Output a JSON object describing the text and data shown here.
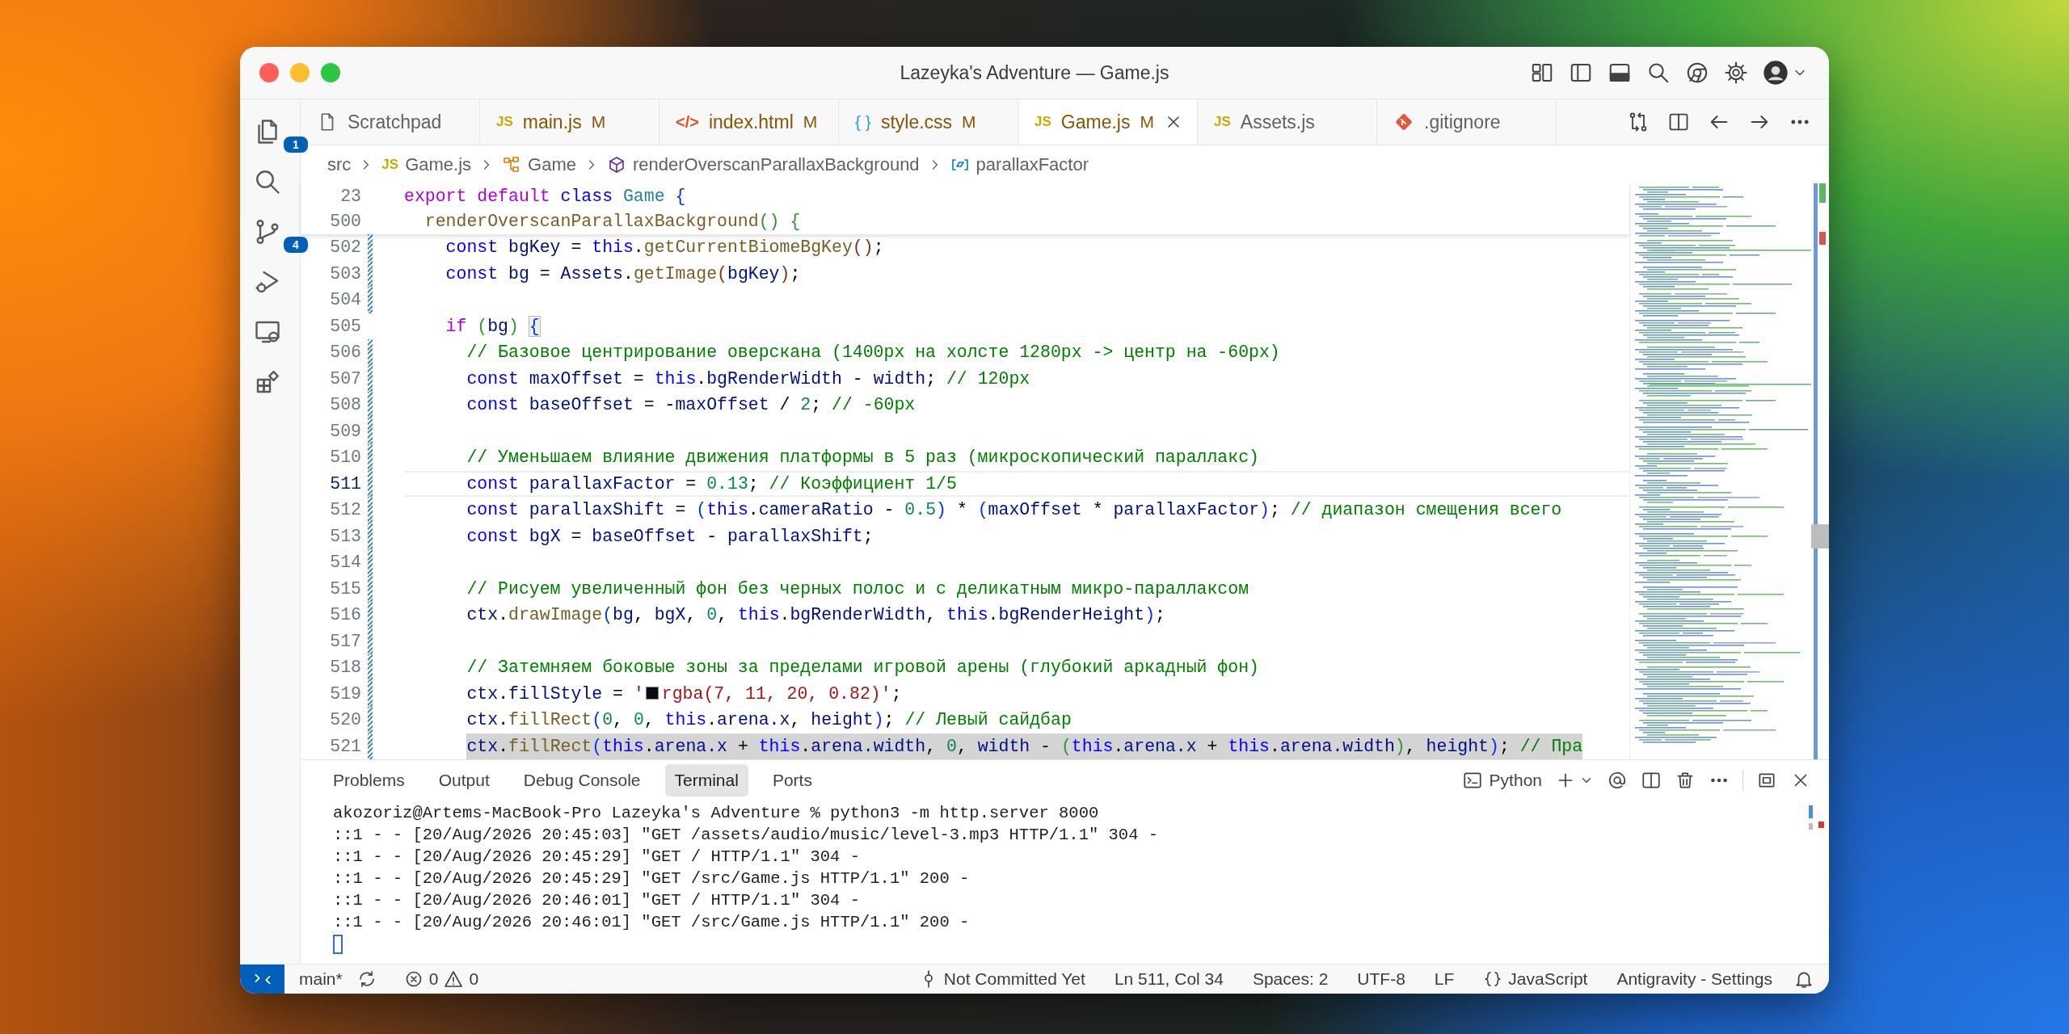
{
  "window": {
    "title": "Lazeyka's Adventure — Game.js"
  },
  "activity_bar": [
    {
      "kind": "explorer",
      "badge": "1"
    },
    {
      "kind": "search"
    },
    {
      "kind": "source_control",
      "badge": "4"
    },
    {
      "kind": "run_debug"
    },
    {
      "kind": "remote"
    },
    {
      "kind": "extensions"
    }
  ],
  "tabs": [
    {
      "label": "Scratchpad",
      "kind": "file",
      "selected": false
    },
    {
      "label": "main.js",
      "kind": "js",
      "icon_text": "JS",
      "badge": "M",
      "selected": false
    },
    {
      "label": "index.html",
      "kind": "html",
      "icon_text": "</>",
      "badge": "M",
      "selected": false
    },
    {
      "label": "style.css",
      "kind": "css",
      "icon_text": "{ }",
      "badge": "M",
      "selected": false
    },
    {
      "label": "Game.js",
      "kind": "js",
      "icon_text": "JS",
      "badge": "M",
      "selected": true
    },
    {
      "label": "Assets.js",
      "kind": "js",
      "icon_text": "JS",
      "selected": false
    },
    {
      "label": ".gitignore",
      "kind": "git",
      "selected": false
    }
  ],
  "breadcrumb": [
    {
      "kind": "folder",
      "label": "src"
    },
    {
      "kind": "js",
      "icon_text": "JS",
      "label": "Game.js"
    },
    {
      "kind": "class",
      "label": "Game"
    },
    {
      "kind": "method",
      "label": "renderOverscanParallaxBackground"
    },
    {
      "kind": "field",
      "label": "parallaxFactor"
    }
  ],
  "editor": {
    "sticky_lines": [
      {
        "number": "23",
        "tokens": [
          {
            "kind": "ctrl",
            "text": "export default "
          },
          {
            "kind": "kw",
            "text": "class "
          },
          {
            "kind": "type",
            "text": "Game "
          },
          {
            "kind": "br",
            "text": "{"
          }
        ],
        "children": [
          {
            "number": "500",
            "tokens": [
              {
                "kind": "fn",
                "text": "renderOverscanParallaxBackground"
              },
              {
                "kind": "br2",
                "text": "() {"
              }
            ]
          }
        ]
      }
    ],
    "lines": [
      {
        "number": "502",
        "changed": true,
        "current": false,
        "tokens": [
          {
            "kind": "kw",
            "text": "const "
          },
          {
            "kind": "var",
            "text": "bgKey"
          },
          {
            "kind": "p",
            "text": " = "
          },
          {
            "kind": "kw",
            "text": "this"
          },
          {
            "kind": "p",
            "text": "."
          },
          {
            "kind": "fn",
            "text": "getCurrentBiomeBgKey"
          },
          {
            "kind": "br3",
            "text": "()"
          },
          {
            "kind": "p",
            "text": ";"
          }
        ]
      },
      {
        "number": "503",
        "changed": true,
        "current": false,
        "tokens": [
          {
            "kind": "kw",
            "text": "const "
          },
          {
            "kind": "var",
            "text": "bg"
          },
          {
            "kind": "p",
            "text": " = "
          },
          {
            "kind": "var",
            "text": "Assets"
          },
          {
            "kind": "p",
            "text": "."
          },
          {
            "kind": "fn",
            "text": "getImage"
          },
          {
            "kind": "br3",
            "text": "("
          },
          {
            "kind": "var",
            "text": "bgKey"
          },
          {
            "kind": "br3",
            "text": ")"
          },
          {
            "kind": "p",
            "text": ";"
          }
        ]
      },
      {
        "number": "504",
        "changed": true,
        "current": false
      },
      {
        "number": "505",
        "changed": false,
        "current": false,
        "tokens": [
          {
            "kind": "ctrl",
            "text": "if "
          },
          {
            "kind": "br2",
            "text": "("
          },
          {
            "kind": "var",
            "text": "bg"
          },
          {
            "kind": "br2",
            "text": ") "
          },
          {
            "kind": "brm",
            "text": "{"
          }
        ],
        "children": [
          {
            "number": "506",
            "changed": true,
            "current": false,
            "tokens": [
              {
                "kind": "cm",
                "text": "// Базовое центрирование оверскана (1400px на холсте 1280px -> центр на -60px)"
              }
            ]
          },
          {
            "number": "507",
            "changed": true,
            "current": false,
            "tokens": [
              {
                "kind": "kw",
                "text": "const "
              },
              {
                "kind": "var",
                "text": "maxOffset"
              },
              {
                "kind": "p",
                "text": " = "
              },
              {
                "kind": "kw",
                "text": "this"
              },
              {
                "kind": "p",
                "text": "."
              },
              {
                "kind": "var",
                "text": "bgRenderWidth"
              },
              {
                "kind": "p",
                "text": " - "
              },
              {
                "kind": "var",
                "text": "width"
              },
              {
                "kind": "p",
                "text": "; "
              },
              {
                "kind": "cm",
                "text": "// 120px"
              }
            ]
          },
          {
            "number": "508",
            "changed": true,
            "current": false,
            "tokens": [
              {
                "kind": "kw",
                "text": "const "
              },
              {
                "kind": "var",
                "text": "baseOffset"
              },
              {
                "kind": "p",
                "text": " = -"
              },
              {
                "kind": "var",
                "text": "maxOffset"
              },
              {
                "kind": "p",
                "text": " / "
              },
              {
                "kind": "num",
                "text": "2"
              },
              {
                "kind": "p",
                "text": "; "
              },
              {
                "kind": "cm",
                "text": "// -60px"
              }
            ]
          },
          {
            "number": "509",
            "changed": true,
            "current": false
          },
          {
            "number": "510",
            "changed": true,
            "current": false,
            "tokens": [
              {
                "kind": "cm",
                "text": "// Уменьшаем влияние движения платформы в 5 раз (микроскопический параллакс)"
              }
            ]
          },
          {
            "number": "511",
            "changed": true,
            "current": true,
            "tokens": [
              {
                "kind": "kw",
                "text": "const "
              },
              {
                "kind": "var",
                "text": "parallaxFactor"
              },
              {
                "kind": "p",
                "text": " = "
              },
              {
                "kind": "num",
                "text": "0.13"
              },
              {
                "kind": "p",
                "text": "; "
              },
              {
                "kind": "cm",
                "text": "// Коэффициент 1/5"
              }
            ]
          },
          {
            "number": "512",
            "changed": true,
            "current": false,
            "tokens": [
              {
                "kind": "kw",
                "text": "const "
              },
              {
                "kind": "var",
                "text": "parallaxShift"
              },
              {
                "kind": "p",
                "text": " = "
              },
              {
                "kind": "br",
                "text": "("
              },
              {
                "kind": "kw",
                "text": "this"
              },
              {
                "kind": "p",
                "text": "."
              },
              {
                "kind": "var",
                "text": "cameraRatio"
              },
              {
                "kind": "p",
                "text": " - "
              },
              {
                "kind": "num",
                "text": "0.5"
              },
              {
                "kind": "br",
                "text": ")"
              },
              {
                "kind": "p",
                "text": " * "
              },
              {
                "kind": "br",
                "text": "("
              },
              {
                "kind": "var",
                "text": "maxOffset"
              },
              {
                "kind": "p",
                "text": " * "
              },
              {
                "kind": "var",
                "text": "parallaxFactor"
              },
              {
                "kind": "br",
                "text": ")"
              },
              {
                "kind": "p",
                "text": "; "
              },
              {
                "kind": "cm",
                "text": "// диапазон смещения всего"
              }
            ]
          },
          {
            "number": "513",
            "changed": true,
            "current": false,
            "tokens": [
              {
                "kind": "kw",
                "text": "const "
              },
              {
                "kind": "var",
                "text": "bgX"
              },
              {
                "kind": "p",
                "text": " = "
              },
              {
                "kind": "var",
                "text": "baseOffset"
              },
              {
                "kind": "p",
                "text": " - "
              },
              {
                "kind": "var",
                "text": "parallaxShift"
              },
              {
                "kind": "p",
                "text": ";"
              }
            ]
          },
          {
            "number": "514",
            "changed": true,
            "current": false
          },
          {
            "number": "515",
            "changed": true,
            "current": false,
            "tokens": [
              {
                "kind": "cm",
                "text": "// Рисуем увеличенный фон без черных полос и с деликатным микро-параллаксом"
              }
            ]
          },
          {
            "number": "516",
            "changed": true,
            "current": false,
            "tokens": [
              {
                "kind": "var",
                "text": "ctx"
              },
              {
                "kind": "p",
                "text": "."
              },
              {
                "kind": "fn",
                "text": "drawImage"
              },
              {
                "kind": "br",
                "text": "("
              },
              {
                "kind": "var",
                "text": "bg"
              },
              {
                "kind": "p",
                "text": ", "
              },
              {
                "kind": "var",
                "text": "bgX"
              },
              {
                "kind": "p",
                "text": ", "
              },
              {
                "kind": "num",
                "text": "0"
              },
              {
                "kind": "p",
                "text": ", "
              },
              {
                "kind": "kw",
                "text": "this"
              },
              {
                "kind": "p",
                "text": "."
              },
              {
                "kind": "var",
                "text": "bgRenderWidth"
              },
              {
                "kind": "p",
                "text": ", "
              },
              {
                "kind": "kw",
                "text": "this"
              },
              {
                "kind": "p",
                "text": "."
              },
              {
                "kind": "var",
                "text": "bgRenderHeight"
              },
              {
                "kind": "br",
                "text": ")"
              },
              {
                "kind": "p",
                "text": ";"
              }
            ]
          },
          {
            "number": "517",
            "changed": true,
            "current": false
          },
          {
            "number": "518",
            "changed": true,
            "current": false,
            "tokens": [
              {
                "kind": "cm",
                "text": "// Затемняем боковые зоны за пределами игровой арены (глубокий аркадный фон)"
              }
            ]
          },
          {
            "number": "519",
            "changed": true,
            "current": false,
            "tokens": [
              {
                "kind": "var",
                "text": "ctx"
              },
              {
                "kind": "p",
                "text": "."
              },
              {
                "kind": "var",
                "text": "fillStyle"
              },
              {
                "kind": "p",
                "text": " = "
              },
              {
                "kind": "str",
                "text": "'"
              },
              {
                "kind": "swatch",
                "color": "#070b14"
              },
              {
                "kind": "str",
                "text": "rgba(7, 11, 20, 0.82)'"
              },
              {
                "kind": "p",
                "text": ";"
              }
            ]
          },
          {
            "number": "520",
            "changed": true,
            "current": false,
            "tokens": [
              {
                "kind": "var",
                "text": "ctx"
              },
              {
                "kind": "p",
                "text": "."
              },
              {
                "kind": "fn",
                "text": "fillRect"
              },
              {
                "kind": "br",
                "text": "("
              },
              {
                "kind": "num",
                "text": "0"
              },
              {
                "kind": "p",
                "text": ", "
              },
              {
                "kind": "num",
                "text": "0"
              },
              {
                "kind": "p",
                "text": ", "
              },
              {
                "kind": "kw",
                "text": "this"
              },
              {
                "kind": "p",
                "text": "."
              },
              {
                "kind": "var",
                "text": "arena.x"
              },
              {
                "kind": "p",
                "text": ", "
              },
              {
                "kind": "var",
                "text": "height"
              },
              {
                "kind": "br",
                "text": ")"
              },
              {
                "kind": "p",
                "text": "; "
              },
              {
                "kind": "cm",
                "text": "// Левый сайдбар"
              }
            ]
          },
          {
            "number": "521",
            "changed": true,
            "current": false,
            "selected": true,
            "tokens": [
              {
                "kind": "var",
                "text": "ctx"
              },
              {
                "kind": "p",
                "text": "."
              },
              {
                "kind": "fn",
                "text": "fillRect"
              },
              {
                "kind": "br",
                "text": "("
              },
              {
                "kind": "kw",
                "text": "this"
              },
              {
                "kind": "p",
                "text": "."
              },
              {
                "kind": "var",
                "text": "arena.x"
              },
              {
                "kind": "p",
                "text": " + "
              },
              {
                "kind": "kw",
                "text": "this"
              },
              {
                "kind": "p",
                "text": "."
              },
              {
                "kind": "var",
                "text": "arena.width"
              },
              {
                "kind": "p",
                "text": ", "
              },
              {
                "kind": "num",
                "text": "0"
              },
              {
                "kind": "p",
                "text": ", "
              },
              {
                "kind": "var",
                "text": "width"
              },
              {
                "kind": "p",
                "text": " - "
              },
              {
                "kind": "br2",
                "text": "("
              },
              {
                "kind": "kw",
                "text": "this"
              },
              {
                "kind": "p",
                "text": "."
              },
              {
                "kind": "var",
                "text": "arena.x"
              },
              {
                "kind": "p",
                "text": " + "
              },
              {
                "kind": "kw",
                "text": "this"
              },
              {
                "kind": "p",
                "text": "."
              },
              {
                "kind": "var",
                "text": "arena.width"
              },
              {
                "kind": "br2",
                "text": ")"
              },
              {
                "kind": "p",
                "text": ", "
              },
              {
                "kind": "var",
                "text": "height"
              },
              {
                "kind": "br",
                "text": ")"
              },
              {
                "kind": "p",
                "text": "; "
              },
              {
                "kind": "cm",
                "text": "// Пра"
              }
            ]
          }
        ]
      }
    ]
  },
  "panel": {
    "tabs": [
      {
        "label": "Problems",
        "selected": false
      },
      {
        "label": "Output",
        "selected": false
      },
      {
        "label": "Debug Console",
        "selected": false
      },
      {
        "label": "Terminal",
        "selected": true
      },
      {
        "label": "Ports",
        "selected": false
      }
    ],
    "terminal_profile": "Python",
    "terminal": {
      "lines": [
        "akozoriz@Artems-MacBook-Pro Lazeyka's Adventure % python3 -m http.server 8000",
        "::1 - - [20/Aug/2026 20:45:03] \"GET /assets/audio/music/level-3.mp3 HTTP/1.1\" 304 -",
        "::1 - - [20/Aug/2026 20:45:29] \"GET / HTTP/1.1\" 304 -",
        "::1 - - [20/Aug/2026 20:45:29] \"GET /src/Game.js HTTP/1.1\" 200 -",
        "::1 - - [20/Aug/2026 20:46:01] \"GET / HTTP/1.1\" 304 -",
        "::1 - - [20/Aug/2026 20:46:01] \"GET /src/Game.js HTTP/1.1\" 200 -"
      ],
      "cursor": true
    }
  },
  "status_bar": {
    "branch": "main*",
    "errors": "0",
    "warnings": "0",
    "right": [
      {
        "kind": "commit",
        "label": "Not Committed Yet"
      },
      {
        "kind": "text",
        "label": "Ln 511, Col 34"
      },
      {
        "kind": "text",
        "label": "Spaces: 2"
      },
      {
        "kind": "text",
        "label": "UTF-8"
      },
      {
        "kind": "text",
        "label": "LF"
      },
      {
        "kind": "language",
        "label": "JavaScript"
      },
      {
        "kind": "text",
        "label": "Antigravity - Settings"
      },
      {
        "kind": "bell"
      }
    ]
  }
}
